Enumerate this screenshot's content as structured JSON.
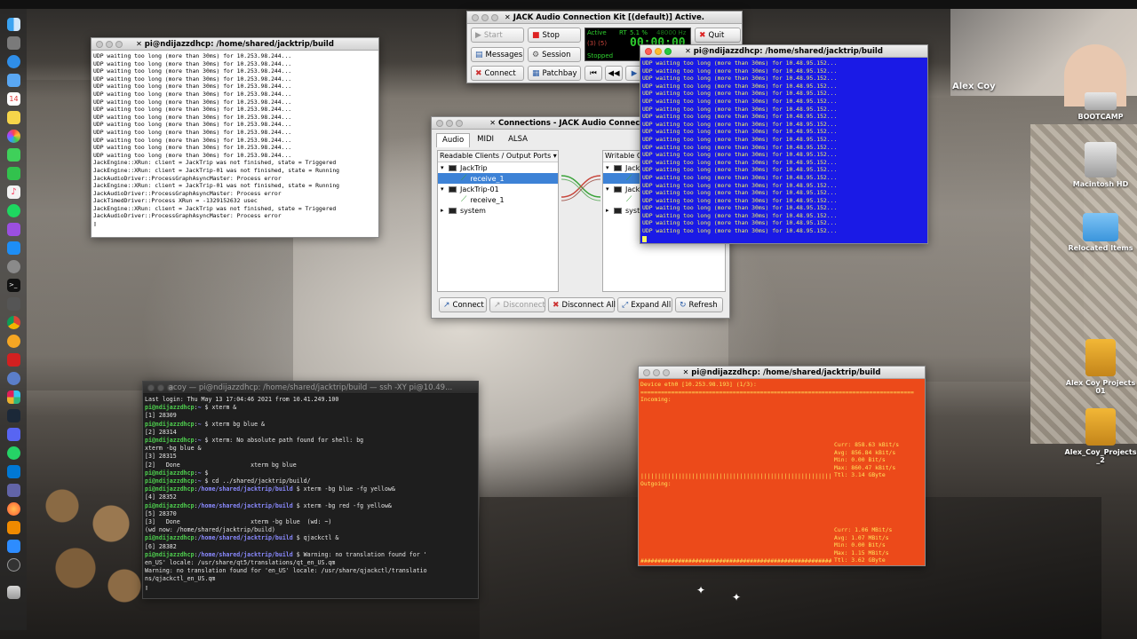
{
  "terminal_top": {
    "title": "pi@ndijazzdhcp: /home/shared/jacktrip/build",
    "lines": [
      "UDP waiting too long (more than 30ms) for 10.253.98.244...",
      "UDP waiting too long (more than 30ms) for 10.253.98.244...",
      "UDP waiting too long (more than 30ms) for 10.253.98.244...",
      "UDP waiting too long (more than 30ms) for 10.253.98.244...",
      "UDP waiting too long (more than 30ms) for 10.253.98.244...",
      "UDP waiting too long (more than 30ms) for 10.253.98.244...",
      "UDP waiting too long (more than 30ms) for 10.253.98.244...",
      "UDP waiting too long (more than 30ms) for 10.253.98.244...",
      "UDP waiting too long (more than 30ms) for 10.253.98.244...",
      "UDP waiting too long (more than 30ms) for 10.253.98.244...",
      "UDP waiting too long (more than 30ms) for 10.253.98.244...",
      "UDP waiting too long (more than 30ms) for 10.253.98.244...",
      "UDP waiting too long (more than 30ms) for 10.253.98.244...",
      "UDP waiting too long (more than 30ms) for 10.253.98.244...",
      "JackEngine::XRun: client = JackTrip was not finished, state = Triggered",
      "JackEngine::XRun: client = JackTrip-01 was not finished, state = Running",
      "JackAudioDriver::ProcessGraphAsyncMaster: Process error",
      "JackEngine::XRun: client = JackTrip-01 was not finished, state = Running",
      "JackAudioDriver::ProcessGraphAsyncMaster: Process error",
      "JackTimedDriver::Process XRun = -1329152632 usec",
      "JackEngine::XRun: client = JackTrip was not finished, state = Triggered",
      "JackAudioDriver::ProcessGraphAsyncMaster: Process error",
      "▯"
    ]
  },
  "jack": {
    "title": "JACK Audio Connection Kit [(default)] Active.",
    "buttons": {
      "start": "Start",
      "stop": "Stop",
      "messages": "Messages",
      "session": "Session",
      "connect": "Connect",
      "patchbay": "Patchbay",
      "quit": "Quit"
    },
    "status": {
      "active": "Active",
      "rt": "RT",
      "dsp": "5.1 %",
      "rate": "48000 Hz",
      "xruns": "(3) (5)",
      "stopped": "Stopped",
      "time": "00:00:00"
    },
    "colors": {
      "display_bg": "#000000",
      "display_fg": "#2fd22f",
      "display_dim": "#1d7b1d"
    }
  },
  "connections": {
    "title": "Connections - JACK Audio Connection Kit",
    "tabs": [
      "Audio",
      "MIDI",
      "ALSA"
    ],
    "left_header": "Readable Clients / Output Ports",
    "right_header": "Writable Clients / Input Ports",
    "left_tree": [
      {
        "label": "JackTrip",
        "type": "client"
      },
      {
        "label": "receive_1",
        "type": "port",
        "selected": true
      },
      {
        "label": "JackTrip-01",
        "type": "client"
      },
      {
        "label": "receive_1",
        "type": "port"
      },
      {
        "label": "system",
        "type": "client",
        "collapsed": true
      }
    ],
    "right_tree": [
      {
        "label": "JackT",
        "type": "client"
      },
      {
        "label": "",
        "type": "port",
        "selected": true
      },
      {
        "label": "JackT",
        "type": "client"
      },
      {
        "label": "",
        "type": "port"
      },
      {
        "label": "syste",
        "type": "client",
        "collapsed": true
      }
    ],
    "buttons": {
      "connect": "Connect",
      "disconnect": "Disconnect",
      "disconnect_all": "Disconnect All",
      "expand_all": "Expand All",
      "refresh": "Refresh"
    },
    "colors": {
      "wire_green": "#3aa33a",
      "wire_red": "#c8463c",
      "select_bg": "#3d82d6"
    }
  },
  "terminal_blue": {
    "title": "pi@ndijazzdhcp: /home/shared/jacktrip/build",
    "line_text": "UDP waiting too long (more than 30ms) for 10.48.95.152...",
    "line_count": 23,
    "colors": {
      "bg": "#1a1ae6",
      "fg": "#f5f560"
    }
  },
  "terminal_ssh": {
    "title": "acoy — pi@ndijazzdhcp: /home/shared/jacktrip/build — ssh -XY pi@10.49...",
    "lines": [
      [
        {
          "t": "Last login: Thu May 13 17:04:46 2021 from 10.41.249.100",
          "c": "w"
        }
      ],
      [
        {
          "t": "pi@ndijazzdhcp",
          "c": "g"
        },
        {
          "t": ":",
          "c": "w"
        },
        {
          "t": "~",
          "c": "b"
        },
        {
          "t": " $ xterm &",
          "c": "w"
        }
      ],
      [
        {
          "t": "[1] 28309",
          "c": "w"
        }
      ],
      [
        {
          "t": "pi@ndijazzdhcp",
          "c": "g"
        },
        {
          "t": ":",
          "c": "w"
        },
        {
          "t": "~",
          "c": "b"
        },
        {
          "t": " $ xterm bg blue &",
          "c": "w"
        }
      ],
      [
        {
          "t": "[2] 28314",
          "c": "w"
        }
      ],
      [
        {
          "t": "pi@ndijazzdhcp",
          "c": "g"
        },
        {
          "t": ":",
          "c": "w"
        },
        {
          "t": "~",
          "c": "b"
        },
        {
          "t": " $ xterm: No absolute path found for shell: bg",
          "c": "w"
        }
      ],
      [
        {
          "t": "xterm -bg blue &",
          "c": "w"
        }
      ],
      [
        {
          "t": "[3] 28315",
          "c": "w"
        }
      ],
      [
        {
          "t": "[2]   Done                    xterm bg blue",
          "c": "w"
        }
      ],
      [
        {
          "t": "pi@ndijazzdhcp",
          "c": "g"
        },
        {
          "t": ":",
          "c": "w"
        },
        {
          "t": "~",
          "c": "b"
        },
        {
          "t": " $",
          "c": "w"
        }
      ],
      [
        {
          "t": "pi@ndijazzdhcp",
          "c": "g"
        },
        {
          "t": ":",
          "c": "w"
        },
        {
          "t": "~",
          "c": "b"
        },
        {
          "t": " $ cd ../shared/jacktrip/build/",
          "c": "w"
        }
      ],
      [
        {
          "t": "pi@ndijazzdhcp",
          "c": "g"
        },
        {
          "t": ":",
          "c": "w"
        },
        {
          "t": "/home/shared/jacktrip/build",
          "c": "b"
        },
        {
          "t": " $ xterm -bg blue -fg yellow&",
          "c": "w"
        }
      ],
      [
        {
          "t": "[4] 28352",
          "c": "w"
        }
      ],
      [
        {
          "t": "pi@ndijazzdhcp",
          "c": "g"
        },
        {
          "t": ":",
          "c": "w"
        },
        {
          "t": "/home/shared/jacktrip/build",
          "c": "b"
        },
        {
          "t": " $ xterm -bg red -fg yellow&",
          "c": "w"
        }
      ],
      [
        {
          "t": "[5] 28370",
          "c": "w"
        }
      ],
      [
        {
          "t": "[3]   Done                    xterm -bg blue  (wd: ~)",
          "c": "w"
        }
      ],
      [
        {
          "t": "(wd now: /home/shared/jacktrip/build)",
          "c": "w"
        }
      ],
      [
        {
          "t": "pi@ndijazzdhcp",
          "c": "g"
        },
        {
          "t": ":",
          "c": "w"
        },
        {
          "t": "/home/shared/jacktrip/build",
          "c": "b"
        },
        {
          "t": " $ qjackctl &",
          "c": "w"
        }
      ],
      [
        {
          "t": "[6] 28382",
          "c": "w"
        }
      ],
      [
        {
          "t": "pi@ndijazzdhcp",
          "c": "g"
        },
        {
          "t": ":",
          "c": "w"
        },
        {
          "t": "/home/shared/jacktrip/build",
          "c": "b"
        },
        {
          "t": " $ Warning: no translation found for '",
          "c": "w"
        }
      ],
      [
        {
          "t": "en_US' locale: /usr/share/qt5/translations/qt_en_US.qm",
          "c": "w"
        }
      ],
      [
        {
          "t": "Warning: no translation found for 'en_US' locale: /usr/share/qjackctl/translatio",
          "c": "w"
        }
      ],
      [
        {
          "t": "ns/qjackctl_en_US.qm",
          "c": "w"
        }
      ],
      [
        {
          "t": "▯",
          "c": "w"
        }
      ]
    ]
  },
  "terminal_red": {
    "title": "pi@ndijazzdhcp: /home/shared/jacktrip/build",
    "device": "Device eth0 [10.253.98.193] (1/3):",
    "separator": "================================================================================",
    "incoming_label": "Incoming:",
    "incoming_stats": [
      "Curr: 858.63 kBit/s",
      "Avg: 856.84 kBit/s",
      "Min: 0.00 Bit/s",
      "Max: 860.47 kBit/s",
      "Ttl: 3.14 GByte"
    ],
    "incoming_bar": "|||||||||||||||||||||||||||||||||||||||||||||||||||||||||",
    "outgoing_label": "Outgoing:",
    "outgoing_stats": [
      "Curr: 1.06 MBit/s",
      "Avg: 1.07 MBit/s",
      "Min: 0.00 Bit/s",
      "Max: 1.15 MBit/s",
      "Ttl: 3.62 GByte"
    ],
    "outgoing_bar": "#########################################################",
    "colors": {
      "bg": "#ec4a1a",
      "fg": "#ffe45a"
    }
  },
  "desktop": {
    "items": [
      {
        "name": "bootcamp",
        "label": "BOOTCAMP"
      },
      {
        "name": "macintosh-hd",
        "label": "Macintosh HD"
      },
      {
        "name": "relocated-items",
        "label": "Relocated Items"
      },
      {
        "name": "alex-coy-projects-01",
        "label": "Alex Coy Projects 01"
      },
      {
        "name": "alex-coy-projects-2",
        "label": "Alex_Coy_Projects _2"
      }
    ],
    "video_name": "Alex Coy"
  }
}
